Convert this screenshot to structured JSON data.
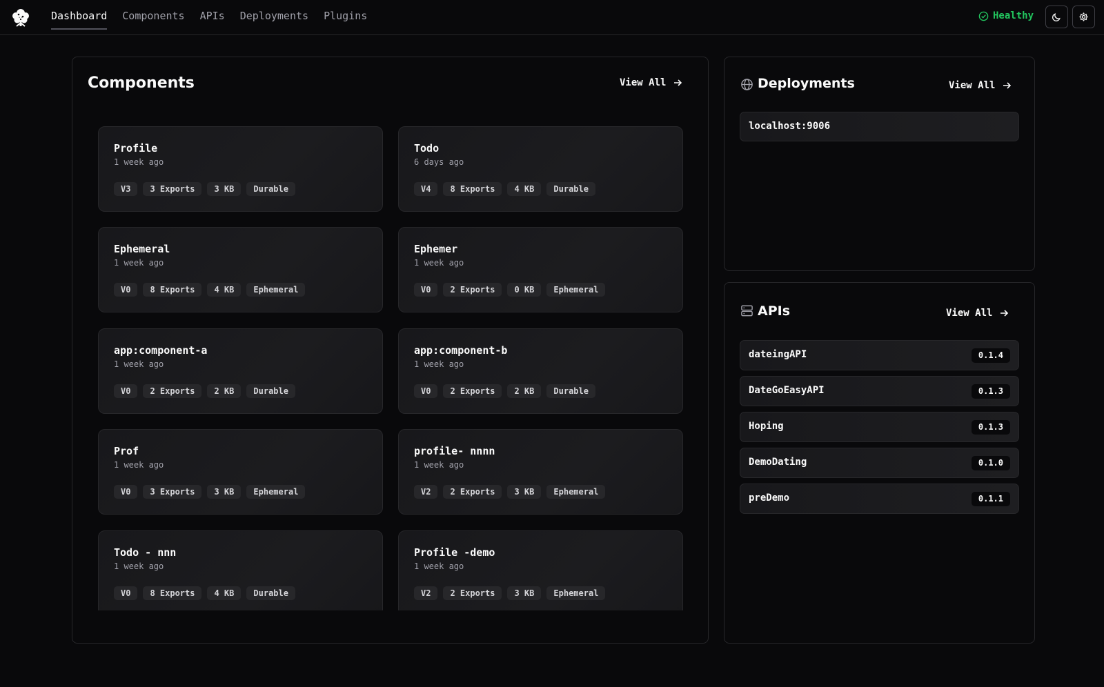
{
  "nav": {
    "items": [
      {
        "label": "Dashboard",
        "active": true
      },
      {
        "label": "Components",
        "active": false
      },
      {
        "label": "APIs",
        "active": false
      },
      {
        "label": "Deployments",
        "active": false
      },
      {
        "label": "Plugins",
        "active": false
      }
    ],
    "health_label": "Healthy",
    "health_color": "#22c55e"
  },
  "components": {
    "title": "Components",
    "view_all": "View All",
    "cards": [
      {
        "name": "Profile",
        "time": "1 week ago",
        "badges": [
          "V3",
          "3 Exports",
          "3 KB",
          "Durable"
        ]
      },
      {
        "name": "Todo",
        "time": "6 days ago",
        "badges": [
          "V4",
          "8 Exports",
          "4 KB",
          "Durable"
        ]
      },
      {
        "name": "Ephemeral",
        "time": "1 week ago",
        "badges": [
          "V0",
          "8 Exports",
          "4 KB",
          "Ephemeral"
        ]
      },
      {
        "name": "Ephemer",
        "time": "1 week ago",
        "badges": [
          "V0",
          "2 Exports",
          "0 KB",
          "Ephemeral"
        ]
      },
      {
        "name": "app:component-a",
        "time": "1 week ago",
        "badges": [
          "V0",
          "2 Exports",
          "2 KB",
          "Durable"
        ]
      },
      {
        "name": "app:component-b",
        "time": "1 week ago",
        "badges": [
          "V0",
          "2 Exports",
          "2 KB",
          "Durable"
        ]
      },
      {
        "name": "Prof",
        "time": "1 week ago",
        "badges": [
          "V0",
          "3 Exports",
          "3 KB",
          "Ephemeral"
        ]
      },
      {
        "name": "profile- nnnn",
        "time": "1 week ago",
        "badges": [
          "V2",
          "2 Exports",
          "3 KB",
          "Ephemeral"
        ]
      },
      {
        "name": "Todo - nnn",
        "time": "1 week ago",
        "badges": [
          "V0",
          "8 Exports",
          "4 KB",
          "Durable"
        ]
      },
      {
        "name": "Profile -demo",
        "time": "1 week ago",
        "badges": [
          "V2",
          "2 Exports",
          "3 KB",
          "Ephemeral"
        ]
      }
    ]
  },
  "deployments": {
    "title": "Deployments",
    "view_all": "View All",
    "items": [
      "localhost:9006"
    ]
  },
  "apis": {
    "title": "APIs",
    "view_all": "View All",
    "items": [
      {
        "name": "dateingAPI",
        "version": "0.1.4"
      },
      {
        "name": "DateGoEasyAPI",
        "version": "0.1.3"
      },
      {
        "name": "Hoping",
        "version": "0.1.3"
      },
      {
        "name": "DemoDating",
        "version": "0.1.0"
      },
      {
        "name": "preDemo",
        "version": "0.1.1"
      }
    ]
  }
}
